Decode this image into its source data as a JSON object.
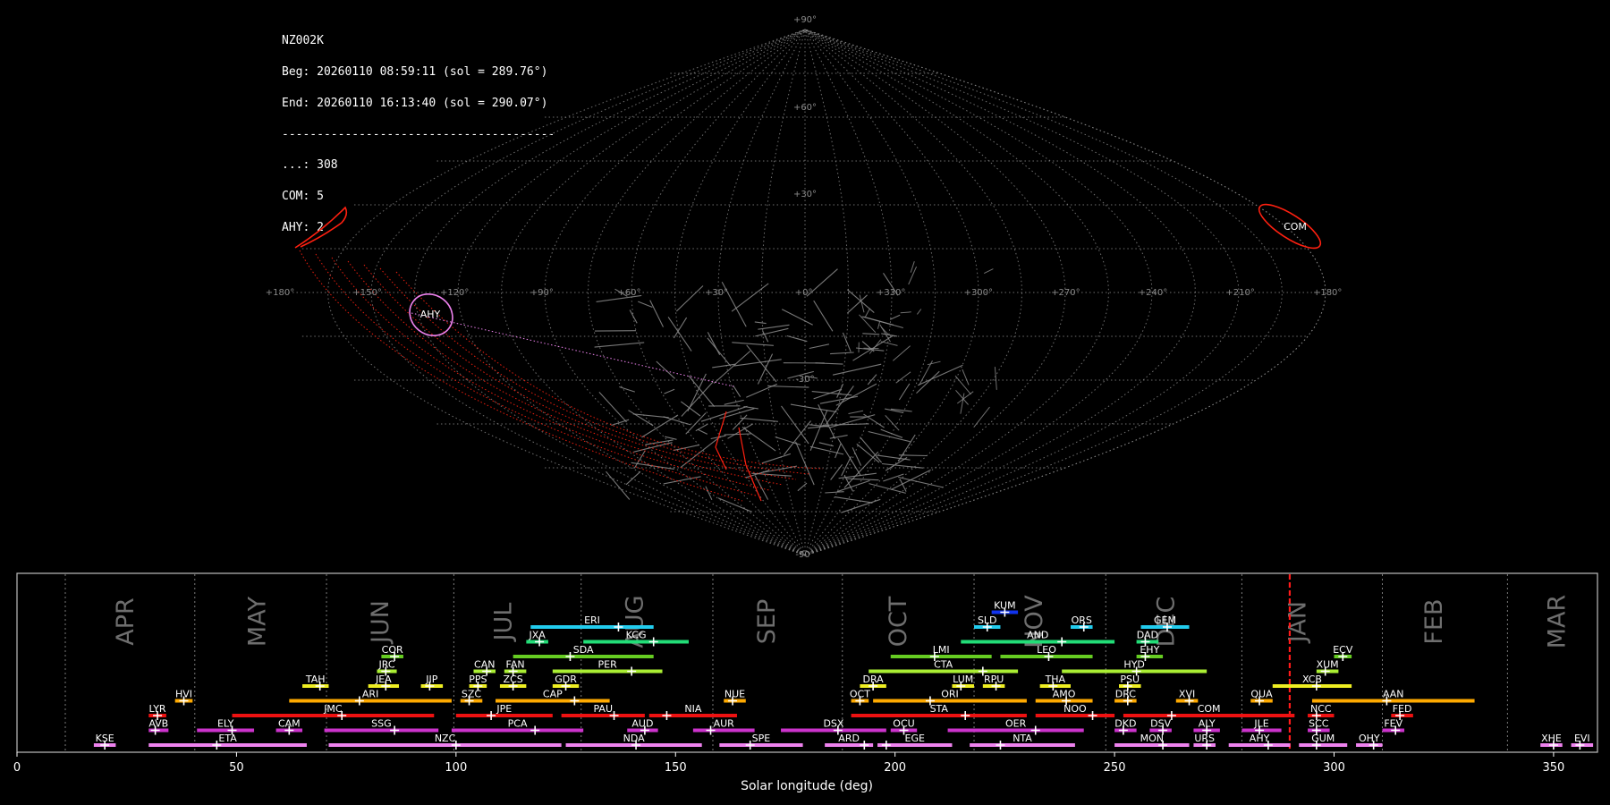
{
  "info": {
    "station": "NZ002K",
    "begin": "Beg: 20260110 08:59:11 (sol = 289.76°)",
    "end": "End: 20260110 16:13:40 (sol = 290.07°)",
    "separator": "---------------------------------------",
    "counts": [
      "...: 308",
      "COM: 5",
      "AHY: 2"
    ]
  },
  "sky_map": {
    "projection": "sinusoidal",
    "lon_tick_labels": [
      "+180°",
      "+150°",
      "+120°",
      "+90°",
      "+60°",
      "+30°",
      "+0°",
      "+330°",
      "+300°",
      "+270°",
      "+240°",
      "+210°",
      "+180°"
    ],
    "lat_tick_labels": [
      "+90°",
      "+60°",
      "+30°",
      "-30°",
      "-90°"
    ],
    "radiants": [
      {
        "label": "COM",
        "ra": 171,
        "dec": 19,
        "color": "#ff2010"
      },
      {
        "label": "AHY",
        "ra": 130,
        "dec": -9,
        "color": "#ee82ee"
      }
    ],
    "colors": {
      "grid": "#8a8a8a",
      "tracks": "#8c8c8c",
      "com": "#ff2010",
      "ahy": "#ee82ee"
    }
  },
  "chart_data": {
    "type": "timeline",
    "xlabel": "Solar longitude (deg)",
    "xlim": [
      0,
      360
    ],
    "xticks": [
      0,
      50,
      100,
      150,
      200,
      250,
      300,
      350
    ],
    "months": [
      {
        "label": "APR",
        "center": 25
      },
      {
        "label": "MAY",
        "center": 55
      },
      {
        "label": "JUN",
        "center": 83
      },
      {
        "label": "JUL",
        "center": 111
      },
      {
        "label": "AUG",
        "center": 141
      },
      {
        "label": "SEP",
        "center": 171
      },
      {
        "label": "OCT",
        "center": 201
      },
      {
        "label": "NOV",
        "center": 232
      },
      {
        "label": "DEC",
        "center": 262
      },
      {
        "label": "JAN",
        "center": 292
      },
      {
        "label": "FEB",
        "center": 323
      },
      {
        "label": "MAR",
        "center": 351
      }
    ],
    "month_boundaries": [
      11,
      40.5,
      70.5,
      99.5,
      128.5,
      158.5,
      188,
      218,
      248,
      279,
      311,
      339.5
    ],
    "current_sol": 289.9,
    "showers": [
      {
        "code": "KSE",
        "start": 17.5,
        "end": 22.5,
        "peak": 20,
        "row": 0,
        "color": "#ee82ee"
      },
      {
        "code": "ETA",
        "start": 30,
        "end": 66,
        "peak": 45.5,
        "row": 0,
        "color": "#ee82ee"
      },
      {
        "code": "NZC",
        "start": 71,
        "end": 124,
        "peak": 100,
        "row": 0,
        "color": "#ee82ee"
      },
      {
        "code": "NDA",
        "start": 125,
        "end": 156,
        "peak": 141,
        "row": 0,
        "color": "#ee82ee"
      },
      {
        "code": "SPE",
        "start": 160,
        "end": 179,
        "peak": 167,
        "row": 0,
        "color": "#ee82ee"
      },
      {
        "code": "ARD",
        "start": 184,
        "end": 195,
        "peak": 193,
        "row": 0,
        "color": "#ee82ee"
      },
      {
        "code": "EGE",
        "start": 196,
        "end": 213,
        "peak": 198,
        "row": 0,
        "color": "#ee82ee"
      },
      {
        "code": "NTA",
        "start": 217,
        "end": 241,
        "peak": 224,
        "row": 0,
        "color": "#ee82ee"
      },
      {
        "code": "MON",
        "start": 250,
        "end": 267,
        "peak": 261,
        "row": 0,
        "color": "#ee82ee"
      },
      {
        "code": "URS",
        "start": 268,
        "end": 273,
        "peak": 271,
        "row": 0,
        "color": "#ee82ee"
      },
      {
        "code": "AHY",
        "start": 276,
        "end": 290,
        "peak": 285,
        "row": 0,
        "color": "#ee82ee"
      },
      {
        "code": "GUM",
        "start": 292,
        "end": 303,
        "peak": 296,
        "row": 0,
        "color": "#ee82ee"
      },
      {
        "code": "OHY",
        "start": 305,
        "end": 311,
        "peak": 309,
        "row": 0,
        "color": "#ee82ee"
      },
      {
        "code": "XHE",
        "start": 347,
        "end": 352,
        "peak": 350,
        "row": 0,
        "color": "#ee82ee"
      },
      {
        "code": "EVI",
        "start": 354,
        "end": 359,
        "peak": 356,
        "row": 0,
        "color": "#ee82ee"
      },
      {
        "code": "AVB",
        "start": 30,
        "end": 34.5,
        "peak": 31.5,
        "row": 1,
        "color": "#cc33cc"
      },
      {
        "code": "ELY",
        "start": 41,
        "end": 54,
        "peak": 49,
        "row": 1,
        "color": "#cc33cc"
      },
      {
        "code": "CAM",
        "start": 59,
        "end": 65,
        "peak": 62,
        "row": 1,
        "color": "#cc33cc"
      },
      {
        "code": "SSG",
        "start": 70,
        "end": 96,
        "peak": 86,
        "row": 1,
        "color": "#cc33cc"
      },
      {
        "code": "PCA",
        "start": 99,
        "end": 129,
        "peak": 118,
        "row": 1,
        "color": "#cc33cc"
      },
      {
        "code": "AUD",
        "start": 139,
        "end": 146,
        "peak": 143,
        "row": 1,
        "color": "#cc33cc"
      },
      {
        "code": "AUR",
        "start": 154,
        "end": 168,
        "peak": 158,
        "row": 1,
        "color": "#cc33cc"
      },
      {
        "code": "DSX",
        "start": 174,
        "end": 198,
        "peak": 187,
        "row": 1,
        "color": "#cc33cc"
      },
      {
        "code": "OCU",
        "start": 199,
        "end": 205,
        "peak": 202,
        "row": 1,
        "color": "#cc33cc"
      },
      {
        "code": "OER",
        "start": 212,
        "end": 243,
        "peak": 232,
        "row": 1,
        "color": "#cc33cc"
      },
      {
        "code": "DKD",
        "start": 250,
        "end": 255,
        "peak": 252,
        "row": 1,
        "color": "#cc33cc"
      },
      {
        "code": "DSV",
        "start": 258,
        "end": 263,
        "peak": 261,
        "row": 1,
        "color": "#cc33cc"
      },
      {
        "code": "ALY",
        "start": 268,
        "end": 274,
        "peak": 271,
        "row": 1,
        "color": "#cc33cc"
      },
      {
        "code": "JLE",
        "start": 279,
        "end": 288,
        "peak": 283,
        "row": 1,
        "color": "#cc33cc"
      },
      {
        "code": "SCC",
        "start": 294,
        "end": 299,
        "peak": 296,
        "row": 1,
        "color": "#cc33cc"
      },
      {
        "code": "FEV",
        "start": 311,
        "end": 316,
        "peak": 314,
        "row": 1,
        "color": "#cc33cc"
      },
      {
        "code": "LYR",
        "start": 30,
        "end": 34,
        "peak": 32,
        "row": 2,
        "color": "#ee1111"
      },
      {
        "code": "JMC",
        "start": 49,
        "end": 95,
        "peak": 74,
        "row": 2,
        "color": "#ee1111"
      },
      {
        "code": "JPE",
        "start": 100,
        "end": 122,
        "peak": 108,
        "row": 2,
        "color": "#ee1111"
      },
      {
        "code": "PAU",
        "start": 124,
        "end": 143,
        "peak": 136,
        "row": 2,
        "color": "#ee1111"
      },
      {
        "code": "NIA",
        "start": 144,
        "end": 164,
        "peak": 148,
        "row": 2,
        "color": "#ee1111"
      },
      {
        "code": "STA",
        "start": 190,
        "end": 230,
        "peak": 216,
        "row": 2,
        "color": "#ee1111"
      },
      {
        "code": "NOO",
        "start": 232,
        "end": 250,
        "peak": 245,
        "row": 2,
        "color": "#ee1111"
      },
      {
        "code": "COM",
        "start": 252,
        "end": 291,
        "peak": 263,
        "row": 2,
        "color": "#ee1111"
      },
      {
        "code": "NCC",
        "start": 294,
        "end": 300,
        "peak": 296,
        "row": 2,
        "color": "#ee1111"
      },
      {
        "code": "FED",
        "start": 313,
        "end": 318,
        "peak": 315,
        "row": 2,
        "color": "#ee1111"
      },
      {
        "code": "HVI",
        "start": 36,
        "end": 40,
        "peak": 38,
        "row": 3,
        "color": "#ffaa00"
      },
      {
        "code": "ARI",
        "start": 62,
        "end": 99,
        "peak": 78,
        "row": 3,
        "color": "#ffaa00"
      },
      {
        "code": "SZC",
        "start": 101,
        "end": 106,
        "peak": 103,
        "row": 3,
        "color": "#ffaa00"
      },
      {
        "code": "CAP",
        "start": 109,
        "end": 135,
        "peak": 127,
        "row": 3,
        "color": "#ffaa00"
      },
      {
        "code": "NUE",
        "start": 161,
        "end": 166,
        "peak": 163,
        "row": 3,
        "color": "#ffaa00"
      },
      {
        "code": "OCT",
        "start": 190,
        "end": 194,
        "peak": 192,
        "row": 3,
        "color": "#ffaa00"
      },
      {
        "code": "ORI",
        "start": 195,
        "end": 230,
        "peak": 208,
        "row": 3,
        "color": "#ffaa00"
      },
      {
        "code": "AMO",
        "start": 232,
        "end": 245,
        "peak": 239,
        "row": 3,
        "color": "#ffaa00"
      },
      {
        "code": "DRC",
        "start": 250,
        "end": 255,
        "peak": 253,
        "row": 3,
        "color": "#ffaa00"
      },
      {
        "code": "XVI",
        "start": 264,
        "end": 269,
        "peak": 267,
        "row": 3,
        "color": "#ffaa00"
      },
      {
        "code": "QUA",
        "start": 281,
        "end": 286,
        "peak": 283,
        "row": 3,
        "color": "#ffaa00"
      },
      {
        "code": "AAN",
        "start": 295,
        "end": 332,
        "peak": 312,
        "row": 3,
        "color": "#ffaa00"
      },
      {
        "code": "TAH",
        "start": 65,
        "end": 71,
        "peak": 69,
        "row": 4,
        "color": "#eeee22"
      },
      {
        "code": "JEA",
        "start": 80,
        "end": 87,
        "peak": 84,
        "row": 4,
        "color": "#eeee22"
      },
      {
        "code": "JIP",
        "start": 92,
        "end": 97,
        "peak": 94,
        "row": 4,
        "color": "#eeee22"
      },
      {
        "code": "PPS",
        "start": 103,
        "end": 107,
        "peak": 105,
        "row": 4,
        "color": "#eeee22"
      },
      {
        "code": "ZCS",
        "start": 110,
        "end": 116,
        "peak": 113,
        "row": 4,
        "color": "#eeee22"
      },
      {
        "code": "GDR",
        "start": 122,
        "end": 128,
        "peak": 125,
        "row": 4,
        "color": "#eeee22"
      },
      {
        "code": "DRA",
        "start": 192,
        "end": 198,
        "peak": 195,
        "row": 4,
        "color": "#eeee22"
      },
      {
        "code": "LUM",
        "start": 213,
        "end": 218,
        "peak": 215,
        "row": 4,
        "color": "#eeee22"
      },
      {
        "code": "RPU",
        "start": 220,
        "end": 225,
        "peak": 223,
        "row": 4,
        "color": "#eeee22"
      },
      {
        "code": "THA",
        "start": 233,
        "end": 240,
        "peak": 236,
        "row": 4,
        "color": "#eeee22"
      },
      {
        "code": "PSU",
        "start": 251,
        "end": 256,
        "peak": 253,
        "row": 4,
        "color": "#eeee22"
      },
      {
        "code": "XCB",
        "start": 286,
        "end": 304,
        "peak": 296,
        "row": 4,
        "color": "#eeee22"
      },
      {
        "code": "JRC",
        "start": 82,
        "end": 86.5,
        "peak": 84,
        "row": 5,
        "color": "#aaee33"
      },
      {
        "code": "CAN",
        "start": 104,
        "end": 109,
        "peak": 107,
        "row": 5,
        "color": "#aaee33"
      },
      {
        "code": "FAN",
        "start": 111,
        "end": 116,
        "peak": 113,
        "row": 5,
        "color": "#aaee33"
      },
      {
        "code": "PER",
        "start": 122,
        "end": 147,
        "peak": 140,
        "row": 5,
        "color": "#aaee33"
      },
      {
        "code": "CTA",
        "start": 194,
        "end": 228,
        "peak": 220,
        "row": 5,
        "color": "#aaee33"
      },
      {
        "code": "HYD",
        "start": 238,
        "end": 271,
        "peak": 255,
        "row": 5,
        "color": "#aaee33"
      },
      {
        "code": "XUM",
        "start": 296,
        "end": 301,
        "peak": 298,
        "row": 5,
        "color": "#aaee33"
      },
      {
        "code": "COR",
        "start": 83,
        "end": 88,
        "peak": 86,
        "row": 6,
        "color": "#66cc22"
      },
      {
        "code": "SDA",
        "start": 113,
        "end": 145,
        "peak": 126,
        "row": 6,
        "color": "#66cc22"
      },
      {
        "code": "LMI",
        "start": 199,
        "end": 222,
        "peak": 209,
        "row": 6,
        "color": "#66cc22"
      },
      {
        "code": "LEO",
        "start": 224,
        "end": 245,
        "peak": 235,
        "row": 6,
        "color": "#66cc22"
      },
      {
        "code": "EHY",
        "start": 255,
        "end": 261,
        "peak": 257,
        "row": 6,
        "color": "#66cc22"
      },
      {
        "code": "ECV",
        "start": 300,
        "end": 304,
        "peak": 302,
        "row": 6,
        "color": "#66cc22"
      },
      {
        "code": "JXA",
        "start": 116,
        "end": 121,
        "peak": 119,
        "row": 7,
        "color": "#22dd77"
      },
      {
        "code": "KCG",
        "start": 129,
        "end": 153,
        "peak": 145,
        "row": 7,
        "color": "#22dd77"
      },
      {
        "code": "AND",
        "start": 215,
        "end": 250,
        "peak": 238,
        "row": 7,
        "color": "#22dd77"
      },
      {
        "code": "DAD",
        "start": 255,
        "end": 260,
        "peak": 257,
        "row": 7,
        "color": "#22dd77"
      },
      {
        "code": "ERI",
        "start": 117,
        "end": 145,
        "peak": 137,
        "row": 8,
        "color": "#22ccee"
      },
      {
        "code": "SLD",
        "start": 218,
        "end": 224,
        "peak": 221,
        "row": 8,
        "color": "#22ccee"
      },
      {
        "code": "ORS",
        "start": 240,
        "end": 245,
        "peak": 243,
        "row": 8,
        "color": "#22ccee"
      },
      {
        "code": "GEM",
        "start": 256,
        "end": 267,
        "peak": 262,
        "row": 8,
        "color": "#22ccee"
      },
      {
        "code": "KUM",
        "start": 222,
        "end": 228,
        "peak": 225,
        "row": 9,
        "color": "#1133ee"
      }
    ]
  }
}
